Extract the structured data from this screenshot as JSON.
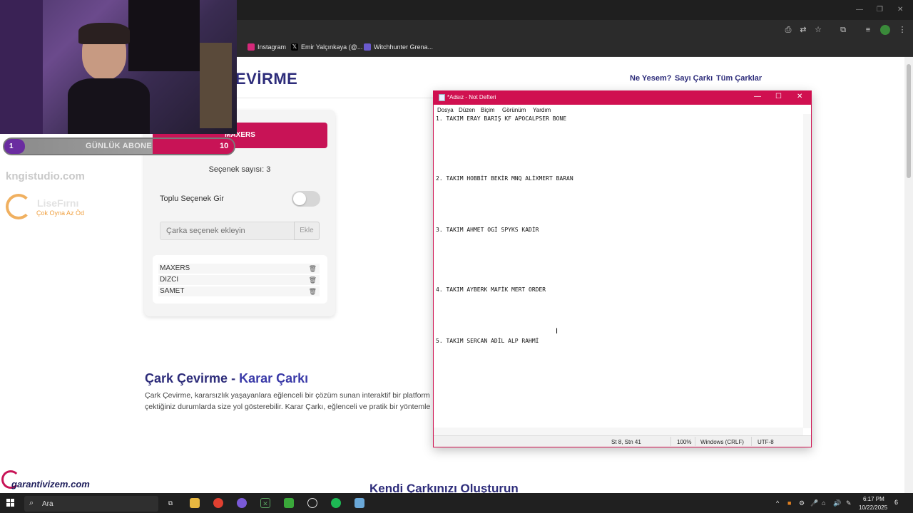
{
  "browser": {
    "bookmarks": [
      {
        "label": "Instagram",
        "icon": "instagram-icon",
        "color": "#d6297a"
      },
      {
        "label": "Emir Yalçınkaya (@...",
        "icon": "x-icon",
        "color": "#000000"
      },
      {
        "label": "Witchhunter Grena...",
        "icon": "shield-icon",
        "color": "#6a5acd"
      }
    ]
  },
  "site": {
    "logo_text": "EVİRME",
    "nav": [
      "Ne Yesem?",
      "Sayı Çarkı",
      "Tüm Çarklar"
    ],
    "result": "MAXERS",
    "option_count": "Seçenek sayısı: 3",
    "bulk_toggle_label": "Toplu Seçenek Gir",
    "bulk_toggle_on": false,
    "add_input_placeholder": "Çarka seçenek ekleyin",
    "add_button": "Ekle",
    "options": [
      "MAXERS",
      "DIZCI",
      "SAMET"
    ],
    "section_title_part1": "Çark Çevirme - ",
    "section_title_part2": "Karar Çarkı",
    "section_text_1": "Çark Çevirme, kararsızlık yaşayanlara eğlenceli bir çözüm sunan interaktif bir platform",
    "section_text_2": "çektiğiniz durumlarda size yol gösterebilir. Karar Çarkı, eğlenceli ve pratik bir yöntemle",
    "bottom_heading": "Kendi Çarkınızı Oluşturun",
    "accent_color": "#c81356",
    "brand_color": "#2d2c7a"
  },
  "overlay": {
    "sub_goal_current": "1",
    "sub_goal_label": "GÜNLÜK ABONE",
    "sub_goal_target": "10",
    "studio_brand": "kngistudio.com",
    "lisa_name": "LiseFırnı",
    "lisa_tagline": "Çok Oyna  Az Öd",
    "garanti_text": "garantivizem.com"
  },
  "notepad": {
    "title": "*Adsız - Not Defteri",
    "menu": [
      "Dosya",
      "Düzen",
      "Biçim",
      "Görünüm",
      "Yardım"
    ],
    "lines": [
      "1. TAKIM ERAY BARIŞ KF APOCALPSER BONE",
      "2. TAKIM HOBBİT BEKİR MNQ ALİXMERT BARAN",
      "3. TAKIM AHMET OGİ SPYKS KADİR",
      "4. TAKIM AYBERK MAFİK MERT ORDER",
      "5. TAKIM SERCAN ADİL ALP RAHMİ"
    ],
    "status_position": "St 8, Stn 41",
    "status_zoom": "100%",
    "status_line_ending": "Windows (CRLF)",
    "status_encoding": "UTF-8"
  },
  "taskbar": {
    "search_label": "Ara",
    "time": "6:17 PM",
    "date": "10/22/2025",
    "notifications": "6"
  }
}
